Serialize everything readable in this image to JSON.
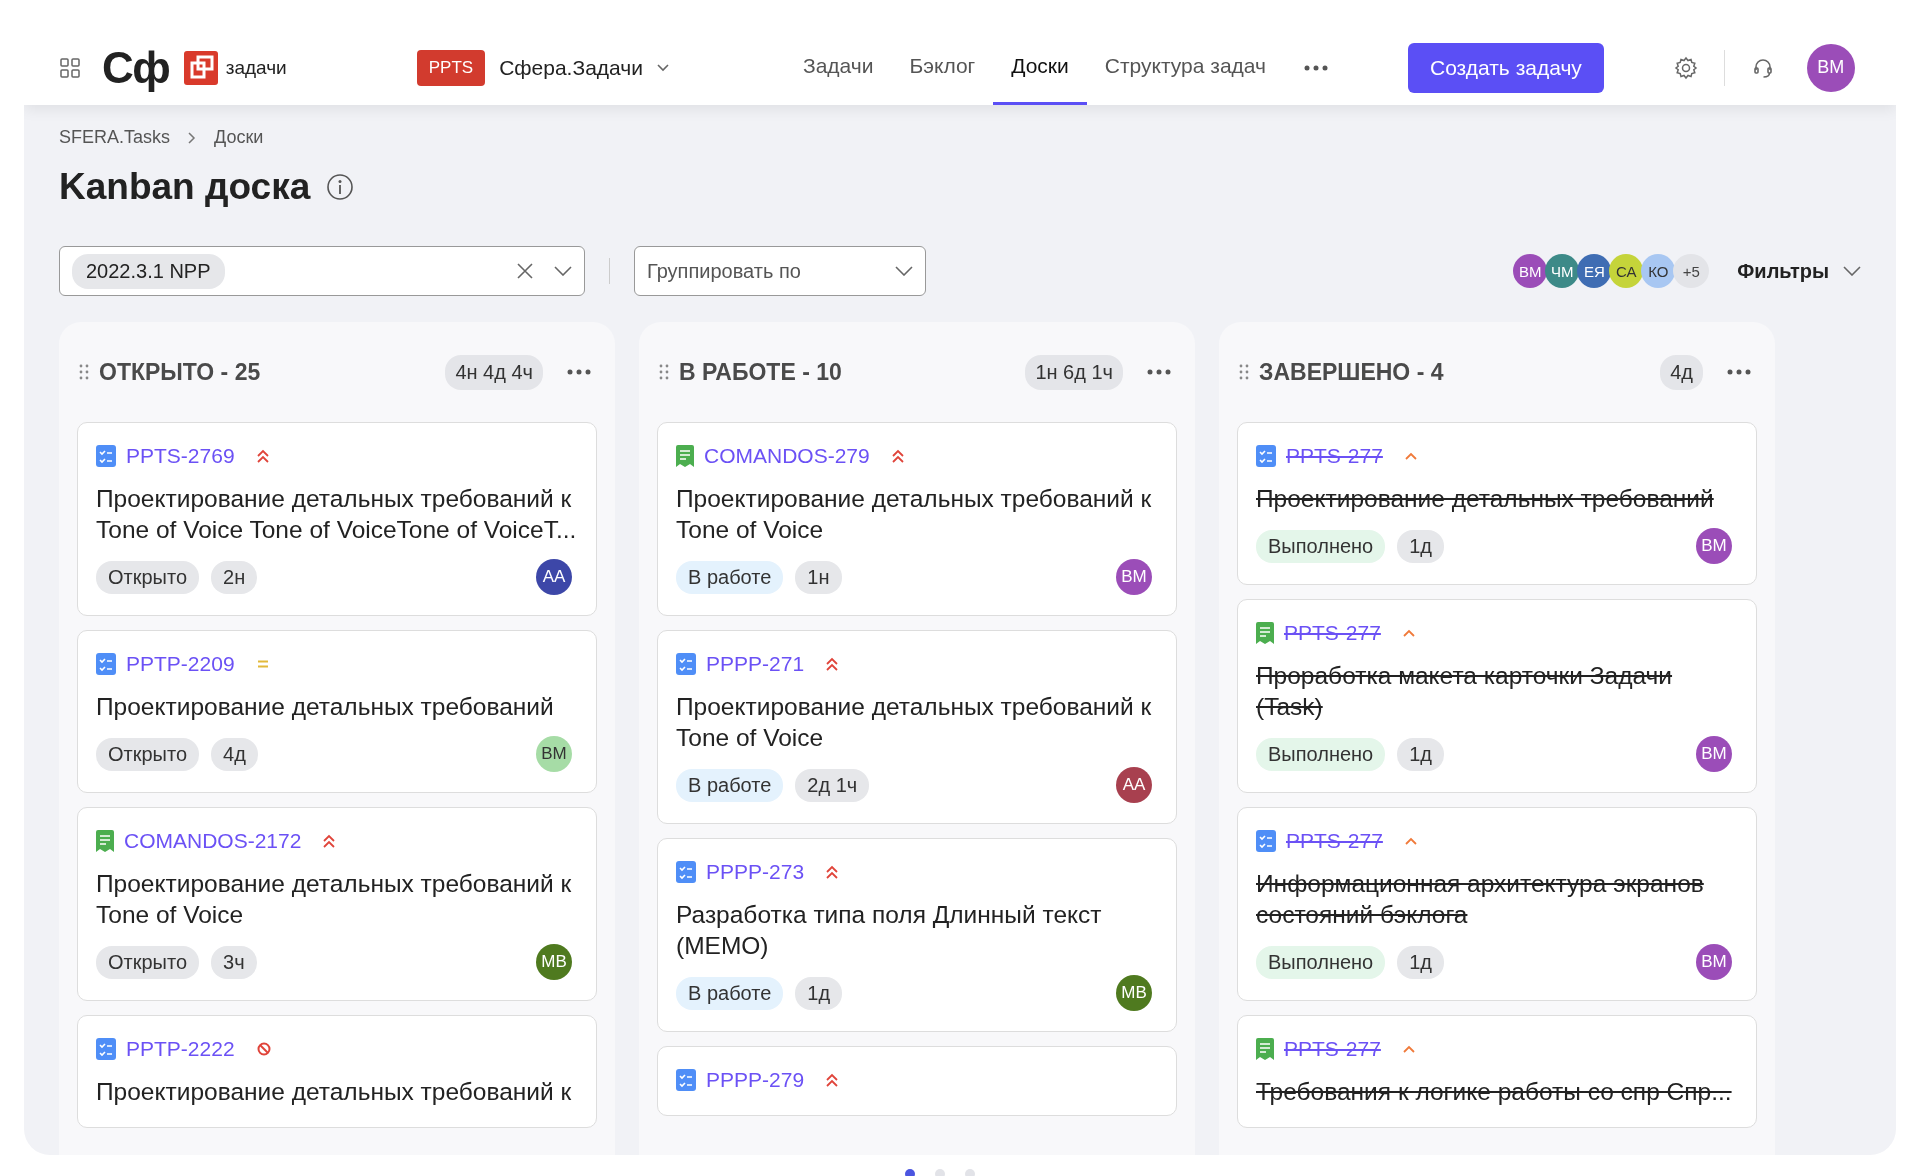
{
  "header": {
    "logo": "Сф",
    "product": "задачи"
  },
  "project": {
    "badge": "PPTS",
    "name": "Сфера.Задачи"
  },
  "nav": [
    {
      "label": "Задачи",
      "selected": false
    },
    {
      "label": "Бэклог",
      "selected": false
    },
    {
      "label": "Доски",
      "selected": true
    },
    {
      "label": "Структура задач",
      "selected": false
    }
  ],
  "create_button": "Создать задачу",
  "user": {
    "initials": "ВМ"
  },
  "breadcrumbs": [
    "SFERA.Tasks",
    "Доски"
  ],
  "title": "Kanban доска",
  "release_filter": {
    "chip": "2022.3.1 NPP"
  },
  "group_by": {
    "placeholder": "Группировать по"
  },
  "assignees": [
    {
      "initials": "ВМ",
      "color": "#9b4db8"
    },
    {
      "initials": "ЧМ",
      "color": "#3d8a88"
    },
    {
      "initials": "ЕЯ",
      "color": "#3f6db3"
    },
    {
      "initials": "СА",
      "color": "#c5d43a"
    },
    {
      "initials": "КО",
      "color": "#a8c7f2"
    }
  ],
  "assignees_more": "+5",
  "filters_label": "Фильтры",
  "columns": [
    {
      "title": "ОТКРЫТО - 25",
      "total": "4н 4д 4ч",
      "cards": [
        {
          "kind": "task",
          "key": "PPTS-2769",
          "priority": {
            "kind": "highest"
          },
          "title": "Проектирование детальных требований к Tone of Voice Tone of VoiceTone of VoiceT...",
          "done": false,
          "status": {
            "kind": "open",
            "label": "Открыто"
          },
          "estimate": "2н",
          "assignee": "АА",
          "color": "#3d47a8"
        },
        {
          "kind": "task",
          "key": "PPTP-2209",
          "priority": {
            "kind": "medium"
          },
          "title": "Проектирование детальных требований",
          "done": false,
          "status": {
            "kind": "open",
            "label": "Открыто"
          },
          "estimate": "4д",
          "assignee": "ВМ",
          "color": "#a6dca6"
        },
        {
          "kind": "story",
          "key": "COMANDOS-2172",
          "priority": {
            "kind": "highest"
          },
          "title": "Проектирование детальных требований к Tone of Voice",
          "done": false,
          "status": {
            "kind": "open",
            "label": "Открыто"
          },
          "estimate": "3ч",
          "assignee": "МВ",
          "color": "#4f7a1f"
        },
        {
          "kind": "task",
          "key": "PPTP-2222",
          "priority": {
            "kind": "blocker"
          },
          "title": "Проектирование детальных требований к",
          "done": false
        }
      ]
    },
    {
      "title": "В РАБОТЕ - 10",
      "total": "1н 6д 1ч",
      "cards": [
        {
          "kind": "story",
          "key": "COMANDOS-279",
          "priority": {
            "kind": "highest"
          },
          "title": "Проектирование детальных требований к Tone of Voice",
          "done": false,
          "status": {
            "kind": "progress",
            "label": "В работе"
          },
          "estimate": "1н",
          "assignee": "ВМ",
          "color": "#9b4db8"
        },
        {
          "kind": "task",
          "key": "PPPP-271",
          "priority": {
            "kind": "highest"
          },
          "title": "Проектирование детальных требований к Tone of Voice",
          "done": false,
          "status": {
            "kind": "progress",
            "label": "В работе"
          },
          "estimate": "2д 1ч",
          "assignee": "АА",
          "color": "#a8404f"
        },
        {
          "kind": "task",
          "key": "PPPP-273",
          "priority": {
            "kind": "highest"
          },
          "title": "Разработка типа поля Длинный текст (MEMO)",
          "done": false,
          "status": {
            "kind": "progress",
            "label": "В работе"
          },
          "estimate": "1д",
          "assignee": "МВ",
          "color": "#4f7a1f"
        },
        {
          "kind": "task",
          "key": "PPPP-279",
          "priority": {
            "kind": "highest"
          },
          "done": false
        }
      ]
    },
    {
      "title": "ЗАВЕРШЕНО - 4",
      "total": "4д",
      "cards": [
        {
          "kind": "task",
          "key": "PPTS-277",
          "priority": {
            "kind": "high"
          },
          "title": "Проектирование детальных требований",
          "done": true,
          "status": {
            "kind": "done",
            "label": "Выполнено"
          },
          "estimate": "1д",
          "assignee": "ВМ",
          "color": "#9b4db8"
        },
        {
          "kind": "story",
          "key": "PPTS-277",
          "priority": {
            "kind": "high"
          },
          "title": "Проработка макета карточки Задачи (Task)",
          "done": true,
          "status": {
            "kind": "done",
            "label": "Выполнено"
          },
          "estimate": "1д",
          "assignee": "ВМ",
          "color": "#9b4db8"
        },
        {
          "kind": "task",
          "key": "PPTS-277",
          "priority": {
            "kind": "high"
          },
          "title": "Информационная архитектура экранов состояний бэклога",
          "done": true,
          "status": {
            "kind": "done",
            "label": "Выполнено"
          },
          "estimate": "1д",
          "assignee": "ВМ",
          "color": "#9b4db8"
        },
        {
          "kind": "story",
          "key": "PPTS-277",
          "priority": {
            "kind": "high"
          },
          "title": "Требования к логике работы со спр Спр...",
          "done": true
        }
      ]
    }
  ],
  "pager": [
    {
      "selected": true
    },
    {
      "selected": false
    },
    {
      "selected": false
    }
  ]
}
